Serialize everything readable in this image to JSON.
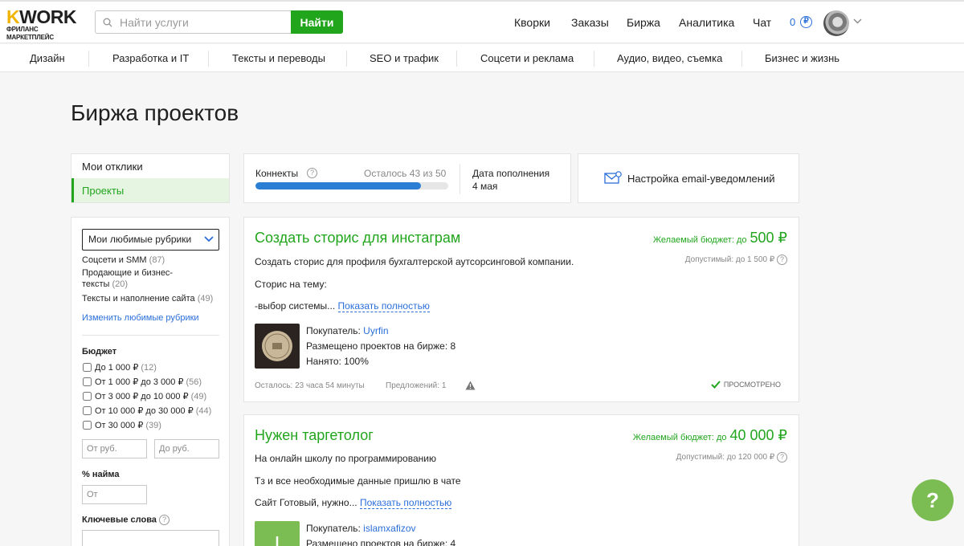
{
  "header": {
    "logo": "KWORK",
    "logo_k": "K",
    "logo_rest": "WORK",
    "logo_sub": "ФРИЛАНС МАРКЕТПЛЕЙС",
    "search_placeholder": "Найти услуги",
    "search_button": "Найти",
    "nav": [
      "Кворки",
      "Заказы",
      "Биржа",
      "Аналитика",
      "Чат"
    ],
    "balance": "0",
    "currency_symbol": "₽"
  },
  "categories": [
    "Дизайн",
    "Разработка и IT",
    "Тексты и переводы",
    "SEO и трафик",
    "Соцсети и реклама",
    "Аудио, видео, съемка",
    "Бизнес и жизнь"
  ],
  "page": {
    "title": "Биржа проектов"
  },
  "sidebar": {
    "items": [
      {
        "label": "Мои отклики",
        "active": false
      },
      {
        "label": "Проекты",
        "active": true
      }
    ]
  },
  "filter": {
    "select_value": "Мои любимые рубрики",
    "rubrics": [
      {
        "label": "Соцсети и SMM",
        "count": "(87)"
      },
      {
        "label": "Продающие и бизнес-тексты",
        "count": "(20)"
      },
      {
        "label": "Тексты и наполнение сайта",
        "count": "(49)"
      }
    ],
    "change_link": "Изменить любимые рубрики",
    "budget_label": "Бюджет",
    "budget_options": [
      {
        "label": "До 1 000 ₽",
        "count": "(12)"
      },
      {
        "label": "От 1 000 ₽ до 3 000 ₽",
        "count": "(56)"
      },
      {
        "label": "От 3 000 ₽ до 10 000 ₽",
        "count": "(49)"
      },
      {
        "label": "От 10 000 ₽ до 30 000 ₽",
        "count": "(44)"
      },
      {
        "label": "От 30 000 ₽",
        "count": "(39)"
      }
    ],
    "from_placeholder": "От руб.",
    "to_placeholder": "До руб.",
    "hire_label": "% найма",
    "hire_placeholder": "От",
    "keywords_label": "Ключевые слова"
  },
  "connects": {
    "label": "Коннекты",
    "remaining": "Осталось 43 из 50",
    "progress": 0.86,
    "refill_label": "Дата пополнения",
    "refill_date": "4 мая"
  },
  "email_settings": {
    "label": "Настройка email-уведомлений"
  },
  "projects": [
    {
      "title": "Создать сторис для инстаграм",
      "budget_label": "Желаемый бюджет: до",
      "budget_value": "500 ₽",
      "allowed": "Допустимый: до 1 500 ₽",
      "desc": [
        "Создать сторис для профиля бухгалтерской аутсорсинговой компании.",
        "Сторис на тему:",
        "-выбор системы..."
      ],
      "show_more": "Показать полностью",
      "buyer_label": "Покупатель:",
      "buyer": "Uyrfin",
      "placed": "Размещено проектов на бирже: 8",
      "hired": "Нанято: 100%",
      "time_left": "Осталось: 23 часа 54 минуты",
      "offers": "Предложений: 1",
      "status": "ПРОСМОТРЕНО"
    },
    {
      "title": "Нужен таргетолог",
      "budget_label": "Желаемый бюджет: до",
      "budget_value": "40 000 ₽",
      "allowed": "Допустимый: до 120 000 ₽",
      "desc": [
        "На онлайн школу по программированию",
        "Тз и все необходимые данные пришлю в чате",
        "Сайт Готовый, нужно..."
      ],
      "show_more": "Показать полностью",
      "buyer_label": "Покупатель:",
      "buyer": "islamxafizov",
      "buyer_initial": "I",
      "placed": "Размещено проектов на бирже: 4"
    }
  ],
  "help_button": "?",
  "colors": {
    "accent_green": "#21a51d",
    "link_blue": "#2a6eda",
    "help_green": "#7bbd52"
  }
}
